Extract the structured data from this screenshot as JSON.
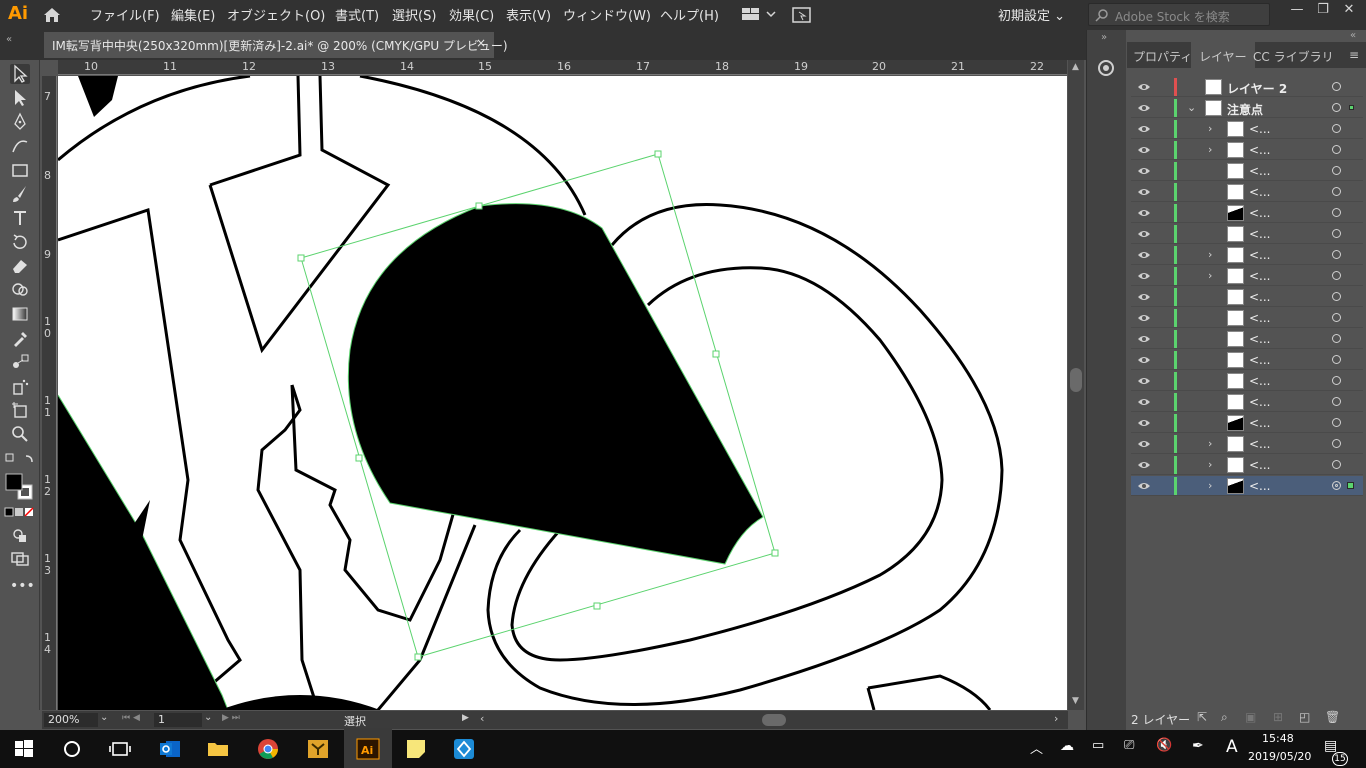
{
  "app": {
    "logo": "Ai",
    "menus": [
      "ファイル(F)",
      "編集(E)",
      "オブジェクト(O)",
      "書式(T)",
      "選択(S)",
      "効果(C)",
      "表示(V)",
      "ウィンドウ(W)",
      "ヘルプ(H)"
    ],
    "workspace_preset": "初期設定",
    "stock_search_placeholder": "Adobe Stock を検索"
  },
  "document_tab": {
    "title": "IM転写背中中央(250x320mm)[更新済み]-2.ai* @ 200% (CMYK/GPU プレビュー)",
    "close": "×"
  },
  "rulers": {
    "top": [
      "10",
      "11",
      "12",
      "13",
      "14",
      "15",
      "16",
      "17",
      "18",
      "19",
      "20",
      "21",
      "22"
    ],
    "left": [
      "7",
      "8",
      "9",
      "10",
      "11",
      "12",
      "13",
      "14"
    ]
  },
  "status_bar": {
    "zoom": "200%",
    "artboard": "1",
    "tool_status": "選択"
  },
  "layers_panel": {
    "tabs": [
      "プロパティ",
      "レイヤー",
      "CC ライブラリ"
    ],
    "active_tab": "レイヤー",
    "layers": [
      {
        "name": "レイヤー 2",
        "level": 0,
        "color": "#e05050"
      },
      {
        "name": "注意点",
        "level": 0,
        "expanded": true,
        "color": "#5bd36e"
      }
    ],
    "sublayer_label": "<...",
    "sublayer_count": 18,
    "selected_index": 17,
    "footer_count": "2 レイヤー"
  },
  "taskbar": {
    "time": "15:48",
    "date": "2019/05/20",
    "ime": "A",
    "notifications": "15"
  }
}
